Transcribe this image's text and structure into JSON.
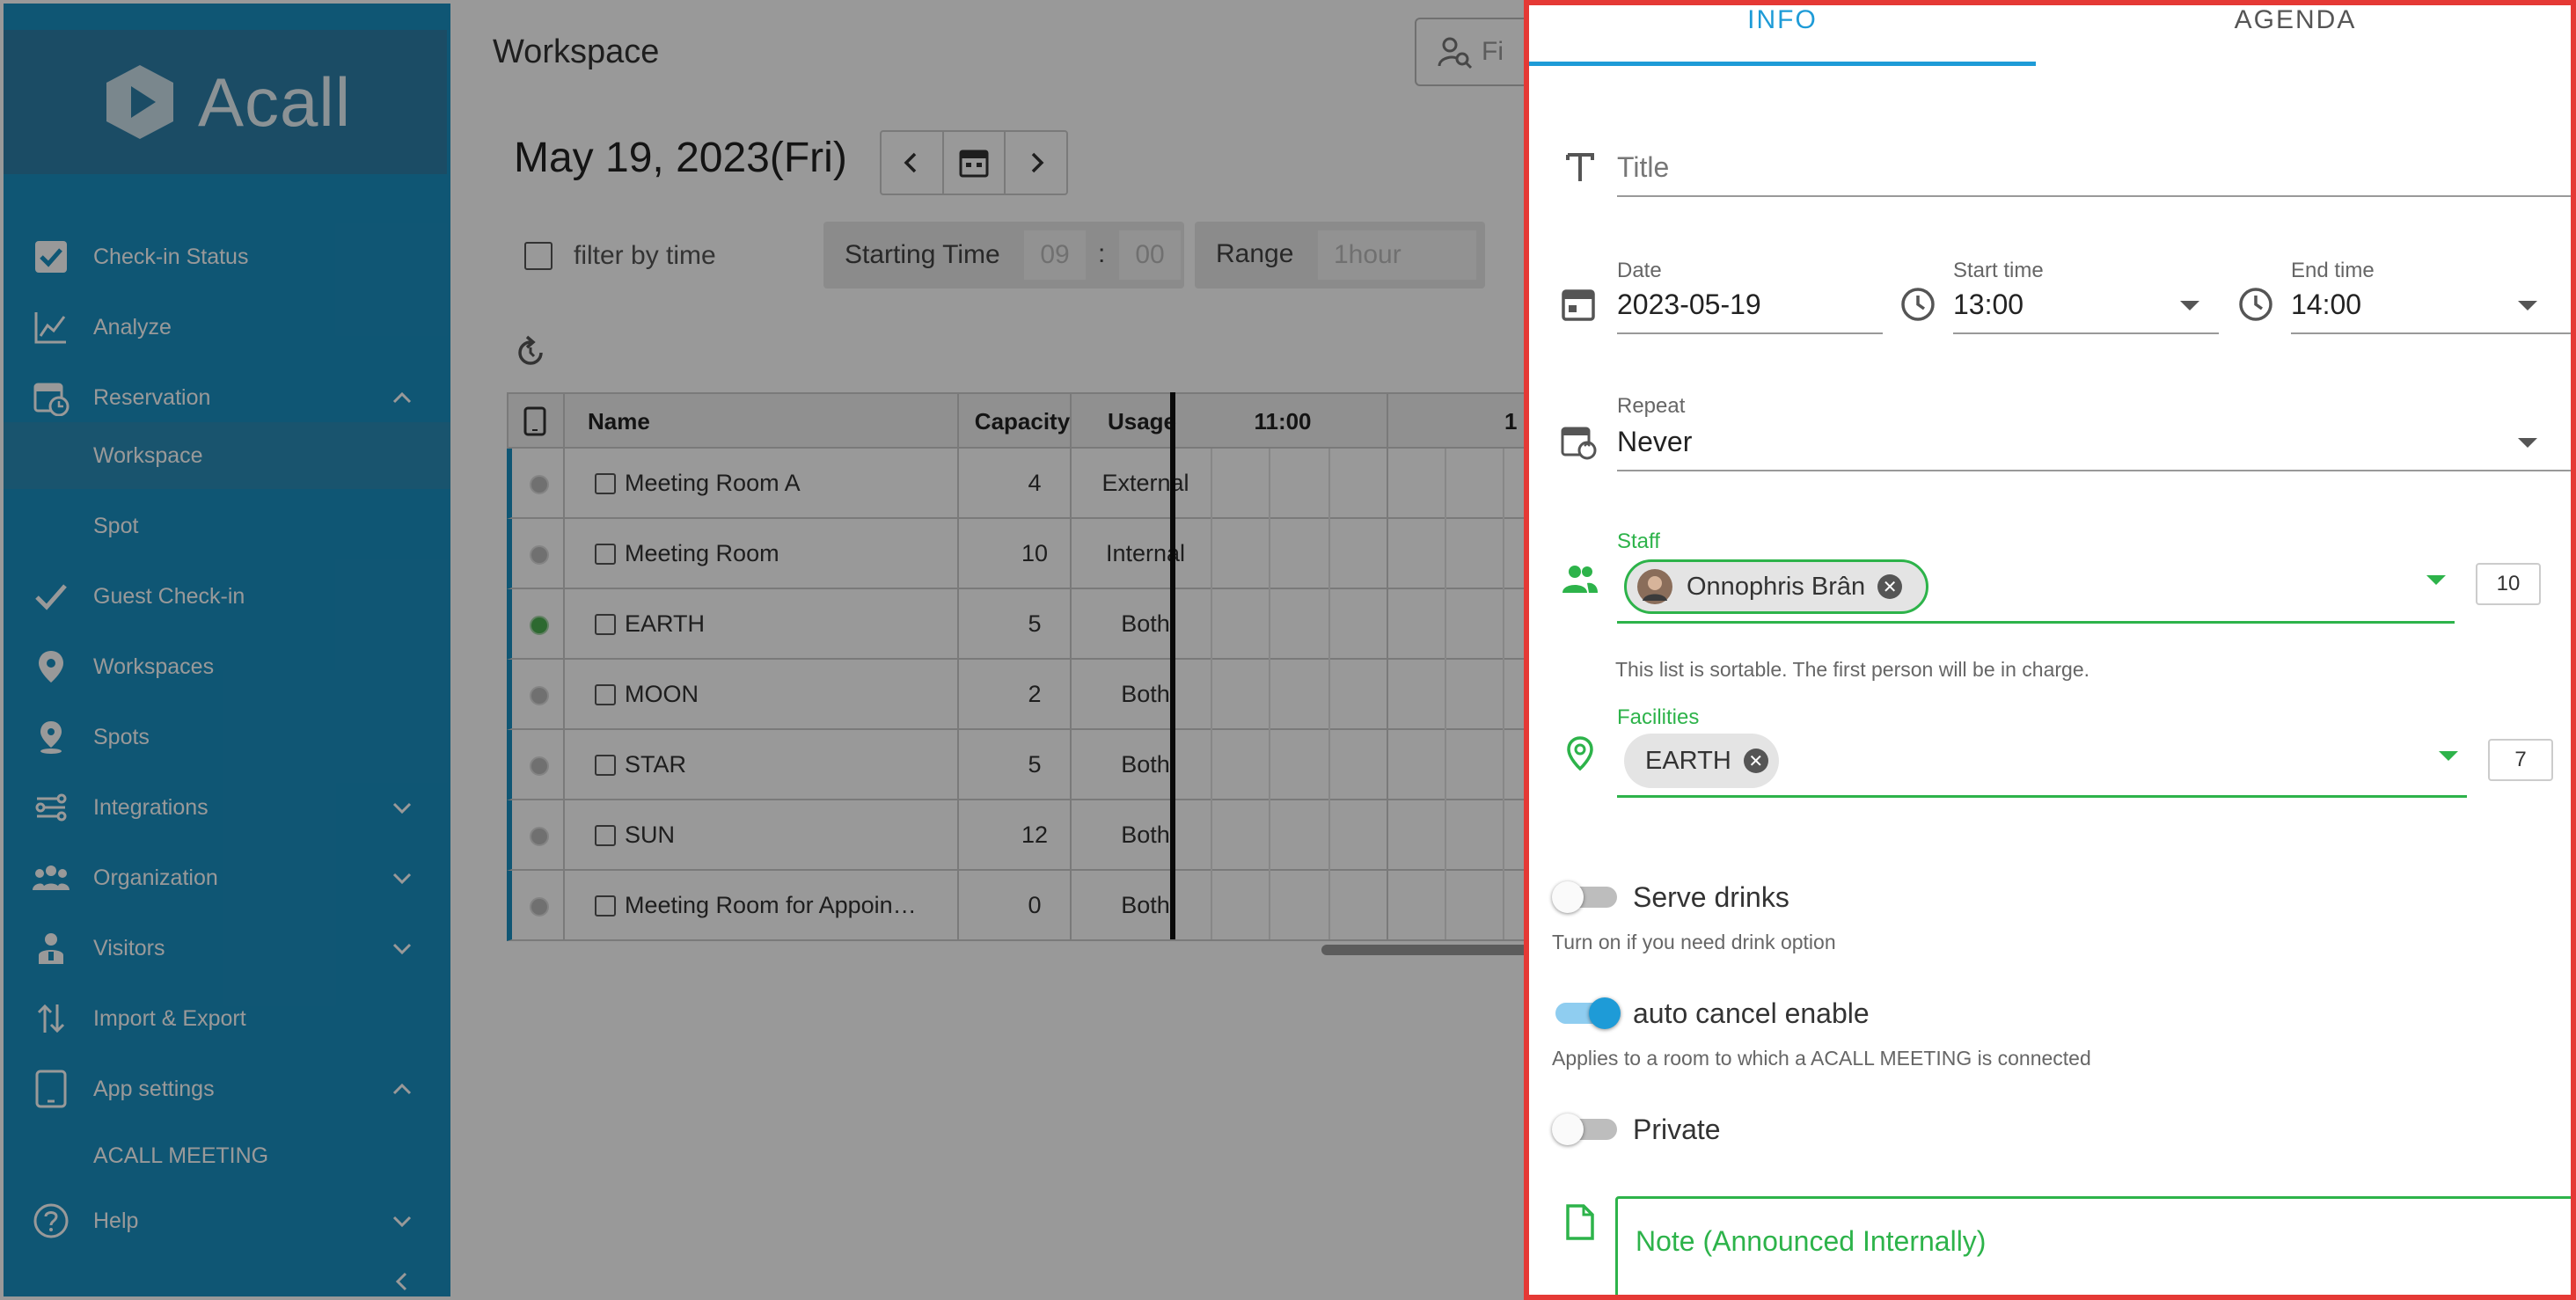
{
  "app": {
    "brand": "Acall"
  },
  "sidebar": {
    "items": [
      {
        "label": "Check-in Status",
        "icon": "check-square-icon"
      },
      {
        "label": "Analyze",
        "icon": "line-chart-icon"
      },
      {
        "label": "Reservation",
        "icon": "calendar-clock-icon",
        "expanded": true
      },
      {
        "label": "Workspace",
        "sub": true,
        "active": true
      },
      {
        "label": "Spot",
        "sub": true
      },
      {
        "label": "Guest Check-in",
        "icon": "checkmark-icon"
      },
      {
        "label": "Workspaces",
        "icon": "location-pin-icon"
      },
      {
        "label": "Spots",
        "icon": "pin-icon"
      },
      {
        "label": "Integrations",
        "icon": "integrations-icon",
        "expanded": false
      },
      {
        "label": "Organization",
        "icon": "group-icon",
        "expanded": false
      },
      {
        "label": "Visitors",
        "icon": "visitor-icon",
        "expanded": false
      },
      {
        "label": "Import & Export",
        "icon": "import-export-icon"
      },
      {
        "label": "App settings",
        "icon": "tablet-icon",
        "expanded": true
      },
      {
        "label": "ACALL MEETING",
        "sub": true
      },
      {
        "label": "Help",
        "icon": "help-icon",
        "expanded": false
      }
    ]
  },
  "main": {
    "title": "Workspace",
    "search_placeholder": "Fi",
    "date": "May 19, 2023(Fri)",
    "filter": {
      "by_time_label": "filter by time",
      "starting_time_label": "Starting Time",
      "hour": "09",
      "sep": ":",
      "minute": "00",
      "range_label": "Range",
      "range_value": "1hour"
    },
    "table": {
      "headers": {
        "name": "Name",
        "capacity": "Capacity",
        "usage": "Usage",
        "time1": "11:00",
        "time2": "1"
      },
      "rows": [
        {
          "name": "Meeting Room A",
          "capacity": "4",
          "usage": "External",
          "status": "grey"
        },
        {
          "name": "Meeting Room",
          "capacity": "10",
          "usage": "Internal",
          "status": "grey"
        },
        {
          "name": "EARTH",
          "capacity": "5",
          "usage": "Both",
          "status": "green"
        },
        {
          "name": "MOON",
          "capacity": "2",
          "usage": "Both",
          "status": "grey"
        },
        {
          "name": "STAR",
          "capacity": "5",
          "usage": "Both",
          "status": "grey"
        },
        {
          "name": "SUN",
          "capacity": "12",
          "usage": "Both",
          "status": "grey"
        },
        {
          "name": "Meeting Room for Appoin…",
          "capacity": "0",
          "usage": "Both",
          "status": "grey"
        }
      ]
    }
  },
  "panel": {
    "tabs": {
      "info": "INFO",
      "agenda": "AGENDA"
    },
    "title_placeholder": "Title",
    "date": {
      "label": "Date",
      "value": "2023-05-19"
    },
    "start_time": {
      "label": "Start time",
      "value": "13:00"
    },
    "end_time": {
      "label": "End time",
      "value": "14:00"
    },
    "repeat": {
      "label": "Repeat",
      "value": "Never"
    },
    "staff": {
      "label": "Staff",
      "chip": "Onnophris Brân",
      "count": "10",
      "hint": "This list is sortable. The first person will be in charge."
    },
    "facilities": {
      "label": "Facilities",
      "chip": "EARTH",
      "count": "7"
    },
    "serve_drinks": {
      "label": "Serve drinks",
      "hint": "Turn on if you need drink option",
      "on": false
    },
    "auto_cancel": {
      "label": "auto cancel enable",
      "hint": "Applies to a room to which a ACALL MEETING is connected",
      "on": true
    },
    "private": {
      "label": "Private",
      "on": false
    },
    "note_placeholder": "Note (Announced Internally)"
  },
  "colors": {
    "sidebar": "#1a8fc2",
    "accent": "#1e9bd7",
    "green": "#2db34a",
    "highlight_border": "#e53935"
  }
}
